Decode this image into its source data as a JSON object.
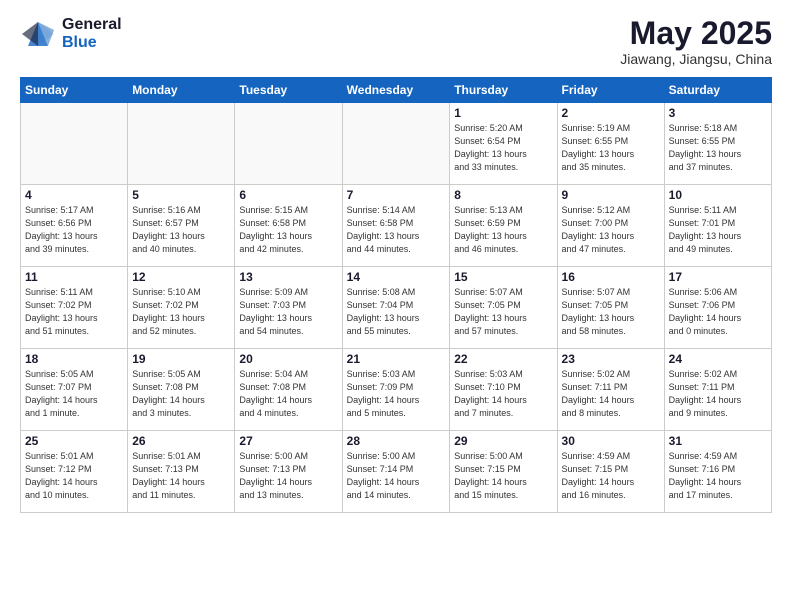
{
  "logo": {
    "general": "General",
    "blue": "Blue"
  },
  "title": "May 2025",
  "location": "Jiawang, Jiangsu, China",
  "weekdays": [
    "Sunday",
    "Monday",
    "Tuesday",
    "Wednesday",
    "Thursday",
    "Friday",
    "Saturday"
  ],
  "weeks": [
    [
      {
        "day": "",
        "info": ""
      },
      {
        "day": "",
        "info": ""
      },
      {
        "day": "",
        "info": ""
      },
      {
        "day": "",
        "info": ""
      },
      {
        "day": "1",
        "info": "Sunrise: 5:20 AM\nSunset: 6:54 PM\nDaylight: 13 hours\nand 33 minutes."
      },
      {
        "day": "2",
        "info": "Sunrise: 5:19 AM\nSunset: 6:55 PM\nDaylight: 13 hours\nand 35 minutes."
      },
      {
        "day": "3",
        "info": "Sunrise: 5:18 AM\nSunset: 6:55 PM\nDaylight: 13 hours\nand 37 minutes."
      }
    ],
    [
      {
        "day": "4",
        "info": "Sunrise: 5:17 AM\nSunset: 6:56 PM\nDaylight: 13 hours\nand 39 minutes."
      },
      {
        "day": "5",
        "info": "Sunrise: 5:16 AM\nSunset: 6:57 PM\nDaylight: 13 hours\nand 40 minutes."
      },
      {
        "day": "6",
        "info": "Sunrise: 5:15 AM\nSunset: 6:58 PM\nDaylight: 13 hours\nand 42 minutes."
      },
      {
        "day": "7",
        "info": "Sunrise: 5:14 AM\nSunset: 6:58 PM\nDaylight: 13 hours\nand 44 minutes."
      },
      {
        "day": "8",
        "info": "Sunrise: 5:13 AM\nSunset: 6:59 PM\nDaylight: 13 hours\nand 46 minutes."
      },
      {
        "day": "9",
        "info": "Sunrise: 5:12 AM\nSunset: 7:00 PM\nDaylight: 13 hours\nand 47 minutes."
      },
      {
        "day": "10",
        "info": "Sunrise: 5:11 AM\nSunset: 7:01 PM\nDaylight: 13 hours\nand 49 minutes."
      }
    ],
    [
      {
        "day": "11",
        "info": "Sunrise: 5:11 AM\nSunset: 7:02 PM\nDaylight: 13 hours\nand 51 minutes."
      },
      {
        "day": "12",
        "info": "Sunrise: 5:10 AM\nSunset: 7:02 PM\nDaylight: 13 hours\nand 52 minutes."
      },
      {
        "day": "13",
        "info": "Sunrise: 5:09 AM\nSunset: 7:03 PM\nDaylight: 13 hours\nand 54 minutes."
      },
      {
        "day": "14",
        "info": "Sunrise: 5:08 AM\nSunset: 7:04 PM\nDaylight: 13 hours\nand 55 minutes."
      },
      {
        "day": "15",
        "info": "Sunrise: 5:07 AM\nSunset: 7:05 PM\nDaylight: 13 hours\nand 57 minutes."
      },
      {
        "day": "16",
        "info": "Sunrise: 5:07 AM\nSunset: 7:05 PM\nDaylight: 13 hours\nand 58 minutes."
      },
      {
        "day": "17",
        "info": "Sunrise: 5:06 AM\nSunset: 7:06 PM\nDaylight: 14 hours\nand 0 minutes."
      }
    ],
    [
      {
        "day": "18",
        "info": "Sunrise: 5:05 AM\nSunset: 7:07 PM\nDaylight: 14 hours\nand 1 minute."
      },
      {
        "day": "19",
        "info": "Sunrise: 5:05 AM\nSunset: 7:08 PM\nDaylight: 14 hours\nand 3 minutes."
      },
      {
        "day": "20",
        "info": "Sunrise: 5:04 AM\nSunset: 7:08 PM\nDaylight: 14 hours\nand 4 minutes."
      },
      {
        "day": "21",
        "info": "Sunrise: 5:03 AM\nSunset: 7:09 PM\nDaylight: 14 hours\nand 5 minutes."
      },
      {
        "day": "22",
        "info": "Sunrise: 5:03 AM\nSunset: 7:10 PM\nDaylight: 14 hours\nand 7 minutes."
      },
      {
        "day": "23",
        "info": "Sunrise: 5:02 AM\nSunset: 7:11 PM\nDaylight: 14 hours\nand 8 minutes."
      },
      {
        "day": "24",
        "info": "Sunrise: 5:02 AM\nSunset: 7:11 PM\nDaylight: 14 hours\nand 9 minutes."
      }
    ],
    [
      {
        "day": "25",
        "info": "Sunrise: 5:01 AM\nSunset: 7:12 PM\nDaylight: 14 hours\nand 10 minutes."
      },
      {
        "day": "26",
        "info": "Sunrise: 5:01 AM\nSunset: 7:13 PM\nDaylight: 14 hours\nand 11 minutes."
      },
      {
        "day": "27",
        "info": "Sunrise: 5:00 AM\nSunset: 7:13 PM\nDaylight: 14 hours\nand 13 minutes."
      },
      {
        "day": "28",
        "info": "Sunrise: 5:00 AM\nSunset: 7:14 PM\nDaylight: 14 hours\nand 14 minutes."
      },
      {
        "day": "29",
        "info": "Sunrise: 5:00 AM\nSunset: 7:15 PM\nDaylight: 14 hours\nand 15 minutes."
      },
      {
        "day": "30",
        "info": "Sunrise: 4:59 AM\nSunset: 7:15 PM\nDaylight: 14 hours\nand 16 minutes."
      },
      {
        "day": "31",
        "info": "Sunrise: 4:59 AM\nSunset: 7:16 PM\nDaylight: 14 hours\nand 17 minutes."
      }
    ]
  ]
}
